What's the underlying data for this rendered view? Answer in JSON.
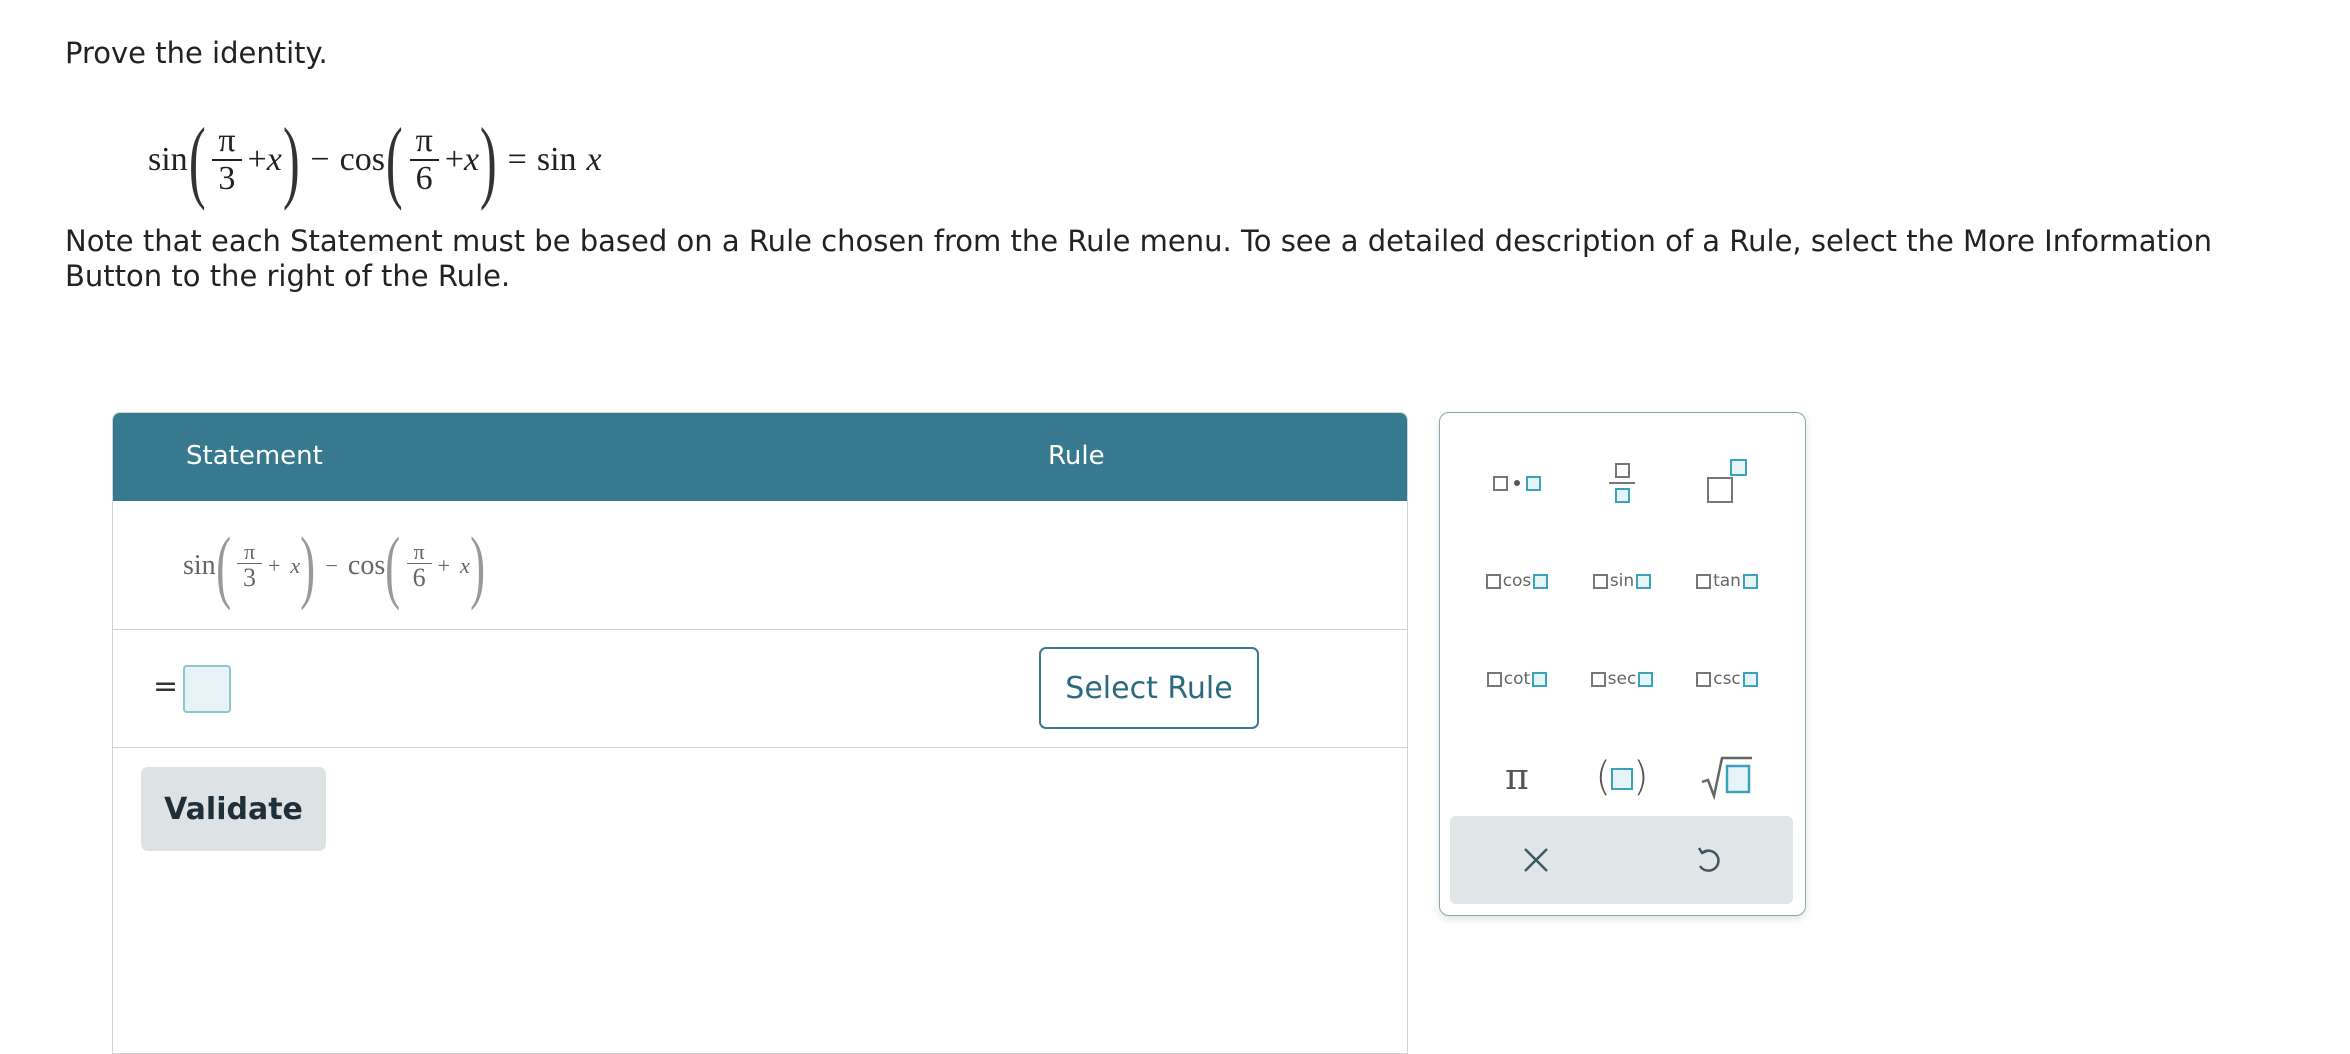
{
  "instruction": "Prove the identity.",
  "identity": {
    "fn1": "sin",
    "frac1": {
      "num": "π",
      "den": "3"
    },
    "plus": "+",
    "var": "x",
    "minus": "−",
    "fn2": "cos",
    "frac2": {
      "num": "π",
      "den": "6"
    },
    "equals": "=",
    "rhs_fn": "sin",
    "rhs_var": "x"
  },
  "note": "Note that each Statement must be based on a Rule chosen from the Rule menu. To see a detailed description of a Rule, select the More Information Button to the right of the Rule.",
  "proof_table": {
    "headers": {
      "statement": "Statement",
      "rule": "Rule"
    },
    "row1": {
      "fn1": "sin",
      "frac1": {
        "num": "π",
        "den": "3"
      },
      "plus": "+",
      "var": "x",
      "minus": "−",
      "fn2": "cos",
      "frac2": {
        "num": "π",
        "den": "6"
      }
    },
    "row2": {
      "equals": "=",
      "rule_button": "Select Rule"
    },
    "validate_label": "Validate"
  },
  "keypad": {
    "pi": "π",
    "trig_functions": [
      "cos",
      "sin",
      "tan",
      "cot",
      "sec",
      "csc"
    ],
    "accent_color": "#377a8f"
  }
}
